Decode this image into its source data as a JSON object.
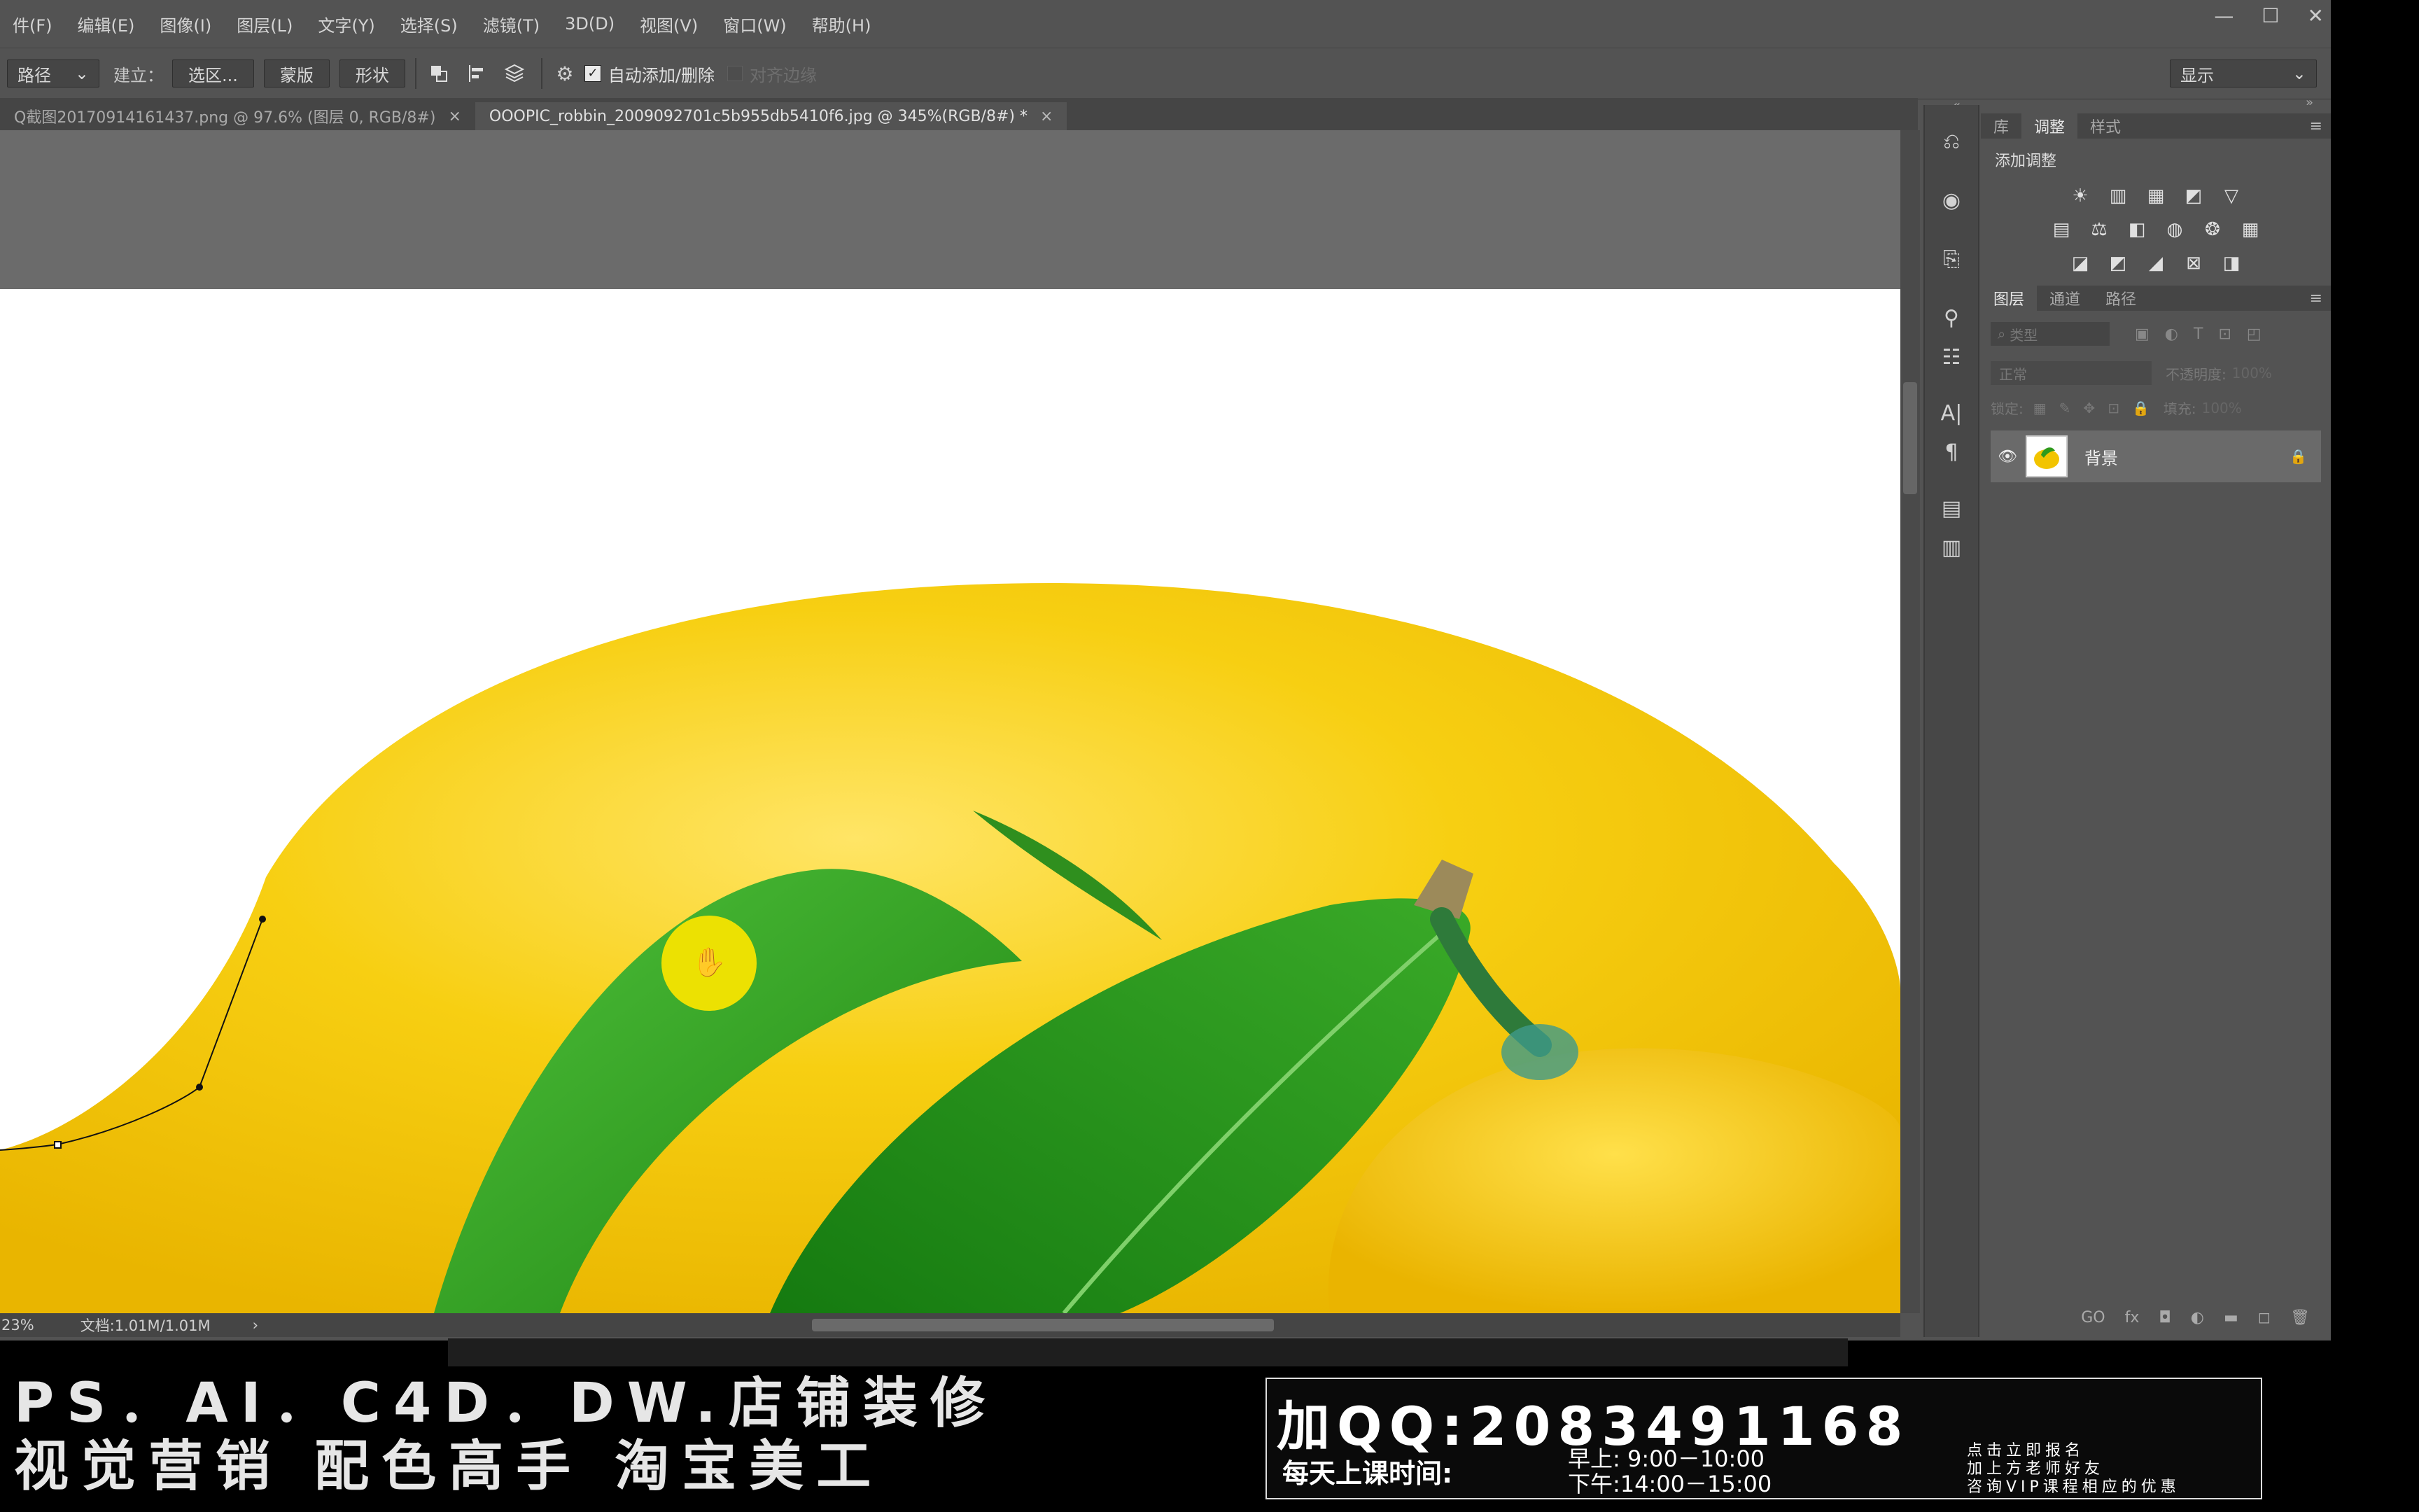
{
  "menu": {
    "items": [
      "件(F)",
      "编辑(E)",
      "图像(I)",
      "图层(L)",
      "文字(Y)",
      "选择(S)",
      "滤镜(T)",
      "3D(D)",
      "视图(V)",
      "窗口(W)",
      "帮助(H)"
    ],
    "window_controls": [
      "—",
      "☐",
      "✕"
    ]
  },
  "options": {
    "path_mode": "路径",
    "make_label": "建立：",
    "selection_btn": "选区...",
    "mask_btn": "蒙版",
    "shape_btn": "形状",
    "auto_add_delete": "自动添加/删除",
    "align_edges": "对齐边缘",
    "workspace": "显示"
  },
  "tabs": [
    {
      "label": "Q截图20170914161437.png @ 97.6% (图层 0, RGB/8#)",
      "close": "×"
    },
    {
      "label": "OOOPIC_robbin_2009092701c5b955db5410f6.jpg @ 345%(RGB/8#) *",
      "close": "×"
    }
  ],
  "status": {
    "zoom": "23%",
    "doc": "文档:1.01M/1.01M",
    "arrow": "›"
  },
  "panel_top": {
    "tabs": [
      "库",
      "调整",
      "样式"
    ],
    "active_tab": "调整",
    "title": "添加调整",
    "menu_icon": "≡"
  },
  "panel_layers": {
    "tabs": [
      "图层",
      "通道",
      "路径"
    ],
    "active_tab": "图层",
    "search_placeholder": "类型",
    "blend_mode": "正常",
    "opacity_label": "不透明度:",
    "opacity_value": "100%",
    "lock_label": "锁定:",
    "fill_label": "填充:",
    "fill_value": "100%",
    "layer_name": "背景",
    "bottom_icons": [
      "GO",
      "fx",
      "◘",
      "◐",
      "▬",
      "◻",
      "🗑"
    ]
  },
  "banner": {
    "line1": "PS．AI．C4D．DW.店铺装修",
    "line2": "视觉营销  配色高手  淘宝美工",
    "qq": "加QQ:2083491168",
    "class_time_label": "每天上课时间:",
    "morning": "早上: 9:00－10:00",
    "afternoon": "下午:14:00－15:00",
    "note1": "点击立即报名",
    "note2": "加上方老师好友",
    "note3": "咨询VIP课程相应的优惠"
  },
  "colors": {
    "ps_bg": "#535353",
    "lemon": "#f2c400",
    "leaf": "#2e9a1c",
    "cursor_highlight": "#f5e400"
  }
}
